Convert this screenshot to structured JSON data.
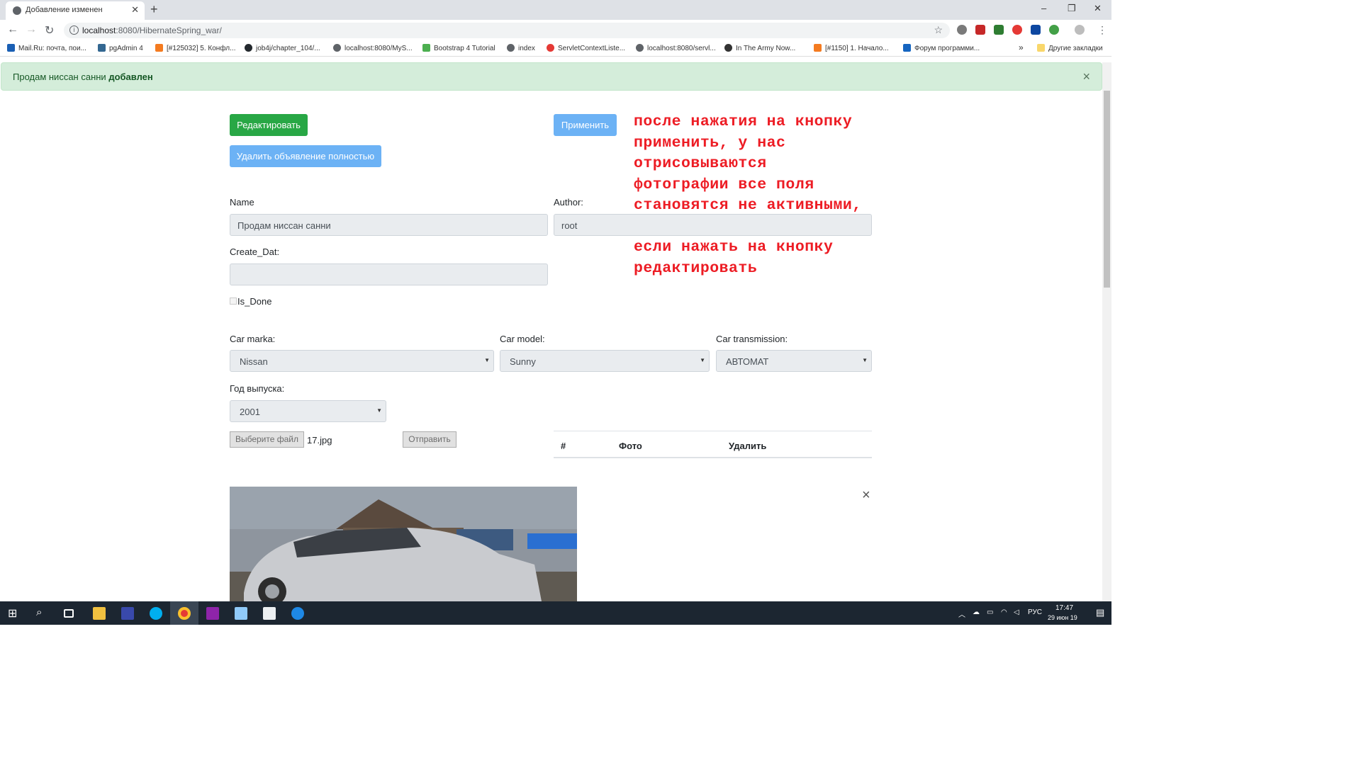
{
  "browser": {
    "tab_title": "Добавление изменен",
    "new_tab": "+",
    "window_controls": {
      "minimize": "–",
      "maximize": "❐",
      "close": "✕"
    },
    "url_host": "localhost",
    "url_rest": ":8080/HibernateSpring_war/",
    "bookmarks": [
      {
        "label": "Mail.Ru: почта, пои...",
        "color": "#1a5fb4"
      },
      {
        "label": "pgAdmin 4",
        "color": "#336791"
      },
      {
        "label": "[#125032] 5. Конфл...",
        "color": "#f47b20"
      },
      {
        "label": "job4j/chapter_104/...",
        "color": "#24292e"
      },
      {
        "label": "localhost:8080/MyS...",
        "color": "#5f6368"
      },
      {
        "label": "Bootstrap 4 Tutorial",
        "color": "#4caf50"
      },
      {
        "label": "index",
        "color": "#5f6368"
      },
      {
        "label": "ServletContextListe...",
        "color": "#e53935"
      },
      {
        "label": "localhost:8080/servl...",
        "color": "#5f6368"
      },
      {
        "label": "In The Army Now...",
        "color": "#333333"
      },
      {
        "label": "[#1150] 1. Начало...",
        "color": "#f47b20"
      },
      {
        "label": "Форум программи...",
        "color": "#1565c0"
      }
    ],
    "bookmarks_more": "»",
    "other_bookmarks": "Другие закладки"
  },
  "alert": {
    "text": "Продам ниссан санни ",
    "bold": "добавлен",
    "close": "×"
  },
  "buttons": {
    "edit": "Редактировать",
    "apply": "Применить",
    "delete_all": "Удалить объявление полностью"
  },
  "form": {
    "name_label": "Name",
    "name_value": "Продам ниссан санни",
    "author_label": "Author:",
    "author_value": "root",
    "create_label": "Create_Dat:",
    "create_value": "",
    "is_done_label": "Is_Done",
    "marka_label": "Car marka:",
    "marka_value": "Nissan",
    "model_label": "Car model:",
    "model_value": "Sunny",
    "transmission_label": "Car transmission:",
    "transmission_value": "АВТОМАТ",
    "year_label": "Год выпуска:",
    "year_value": "2001",
    "caret": "▼"
  },
  "upload": {
    "choose": "Выберите файл",
    "file": "17.jpg",
    "send": "Отправить"
  },
  "table": {
    "col_num": "#",
    "col_photo": "Фото",
    "col_delete": "Удалить"
  },
  "photo_remove": "×",
  "annotation": "после нажатия на кнопку применить, у нас отрисовываются фотографии все поля становятся не активными, активными они станут если нажать на кнопку редактировать",
  "taskbar": {
    "lang": "РУС",
    "time": "17:47",
    "date": "29 июн 19"
  },
  "colors": {
    "success": "#28a745",
    "primary_disabled": "#6cb2f5",
    "alert_bg": "#d4edda",
    "annotation": "#ed1c24",
    "taskbar": "#1c2631"
  }
}
